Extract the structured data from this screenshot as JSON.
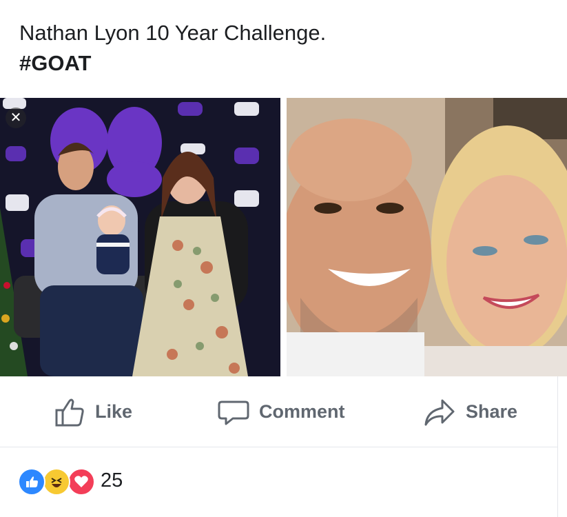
{
  "post": {
    "text_line1": "Nathan Lyon 10 Year Challenge.",
    "hashtag": "#GOAT"
  },
  "photos": {
    "close_symbol": "✕",
    "left_description_icon": "family-photo",
    "right_description_icon": "selfie-photo"
  },
  "actions": {
    "like_label": "Like",
    "comment_label": "Comment",
    "share_label": "Share"
  },
  "reactions": {
    "count": "25",
    "icons": [
      "like-reaction-icon",
      "haha-reaction-icon",
      "love-reaction-icon"
    ]
  },
  "colors": {
    "text": "#1c1e21",
    "action_gray": "#606770",
    "like_blue": "#2d88ff",
    "haha_yellow": "#f7c932",
    "love_red": "#f33e58"
  }
}
